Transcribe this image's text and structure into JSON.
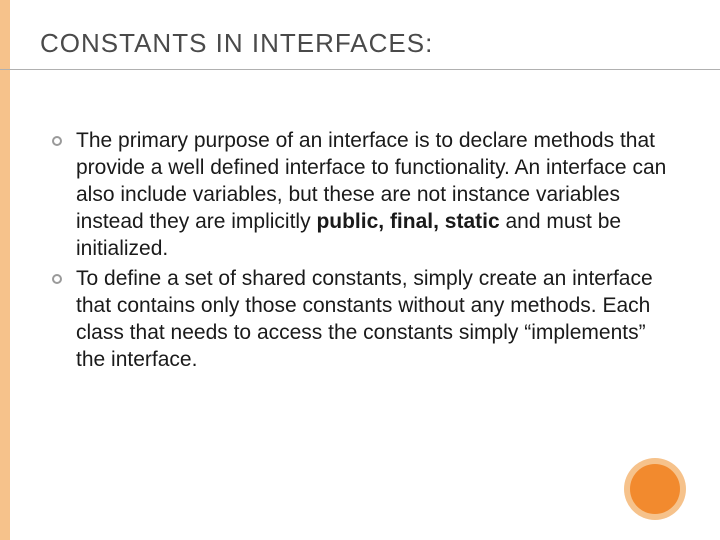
{
  "slide": {
    "title": "CONSTANTS IN INTERFACES:",
    "bullets": [
      {
        "pre": "The primary purpose of an interface is to declare methods that provide a well defined interface to functionality. An interface can also include variables, but these are not instance variables instead they are implicitly ",
        "bold": "public, final, static",
        "post": " and must be initialized."
      },
      {
        "pre": "To define a set of shared constants, simply create an interface that contains only those constants without any methods. Each class that needs to access the constants simply “implements” the interface.",
        "bold": "",
        "post": ""
      }
    ]
  }
}
